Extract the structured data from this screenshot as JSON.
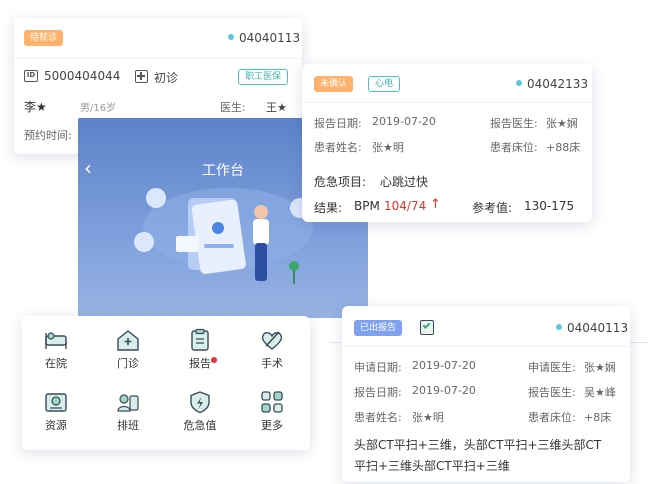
{
  "card_waiting": {
    "status_tag": "待就诊",
    "patient_id": "04040113",
    "record_no": "5000404044",
    "visit_type": "初诊",
    "insurance_tag": "职工医保",
    "patient_name": "李★",
    "gender_age": "男/16岁",
    "doctor_label": "医生:",
    "doctor_name": "王★",
    "appointment_label": "预约时间:"
  },
  "workbench": {
    "title": "工作台"
  },
  "card_alert": {
    "status_tag": "未确认",
    "type_tag": "心电",
    "patient_id": "04042133",
    "report_date_label": "报告日期:",
    "report_date": "2019-07-20",
    "report_doctor_label": "报告医生:",
    "report_doctor": "张★娴",
    "patient_name_label": "患者姓名:",
    "patient_name": "张★明",
    "bed_label": "患者床位:",
    "bed": "+88床",
    "critical_item_label": "危急项目:",
    "critical_item": "心跳过快",
    "result_label": "结果:",
    "result_name": "BPM",
    "result_value": "104/74",
    "result_arrow": "↑",
    "reference_label": "参考值:",
    "reference_value": "130-175",
    "colors": {
      "alert_red": "#e8342e"
    }
  },
  "grid": {
    "items": [
      {
        "label": "在院",
        "icon": "hospital-bed-icon"
      },
      {
        "label": "门诊",
        "icon": "clinic-house-icon"
      },
      {
        "label": "报告",
        "icon": "report-clipboard-icon",
        "has_badge": true
      },
      {
        "label": "手术",
        "icon": "surgery-heart-icon"
      },
      {
        "label": "资源",
        "icon": "resource-icon"
      },
      {
        "label": "排班",
        "icon": "schedule-icon"
      },
      {
        "label": "危急值",
        "icon": "critical-shield-icon"
      },
      {
        "label": "更多",
        "icon": "more-grid-icon"
      }
    ]
  },
  "card_report": {
    "status_tag": "已出报告",
    "patient_id": "04040113",
    "apply_date_label": "申请日期:",
    "apply_date": "2019-07-20",
    "apply_doctor_label": "申请医生:",
    "apply_doctor": "张★娴",
    "report_date_label": "报告日期:",
    "report_date": "2019-07-20",
    "report_doctor_label": "报告医生:",
    "report_doctor": "吴★峰",
    "patient_name_label": "患者姓名:",
    "patient_name": "张★明",
    "bed_label": "患者床位:",
    "bed": "+8床",
    "exam_line1": "头部CT平扫+三维，头部CT平扫+三维头部CT",
    "exam_line2": "平扫+三维头部CT平扫+三维"
  }
}
